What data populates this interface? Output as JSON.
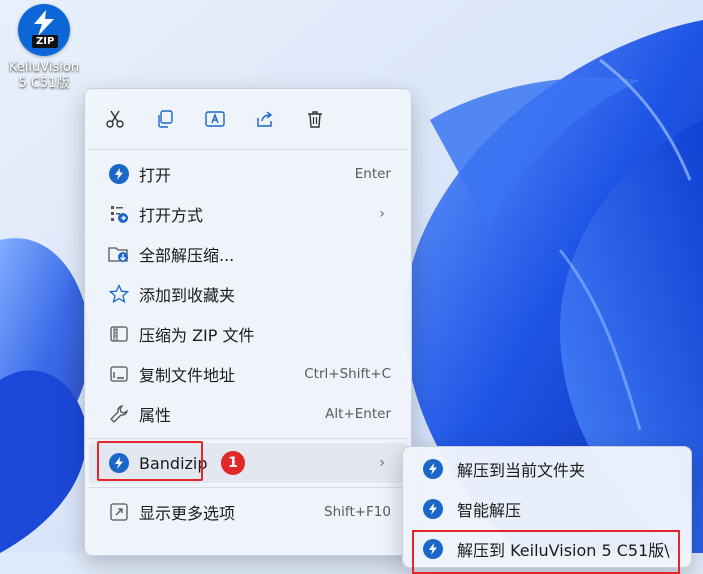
{
  "desktop": {
    "icon_label_line1": "KeiluVision",
    "icon_label_line2": "5 C51版",
    "icon_badge": "ZIP"
  },
  "toolbar": {
    "cut_icon": "scissors-icon",
    "copy_icon": "copy-icon",
    "rename_icon": "rename-icon",
    "share_icon": "share-icon",
    "delete_icon": "trash-icon"
  },
  "menu": {
    "items": [
      {
        "label": "打开",
        "shortcut": "Enter",
        "icon": "bandizip-icon"
      },
      {
        "label": "打开方式",
        "shortcut": "",
        "icon": "open-with-icon",
        "has_submenu": true
      },
      {
        "label": "全部解压缩...",
        "shortcut": "",
        "icon": "extract-all-icon"
      },
      {
        "label": "添加到收藏夹",
        "shortcut": "",
        "icon": "star-icon"
      },
      {
        "label": "压缩为 ZIP 文件",
        "shortcut": "",
        "icon": "zip-file-icon"
      },
      {
        "label": "复制文件地址",
        "shortcut": "Ctrl+Shift+C",
        "icon": "copy-path-icon"
      },
      {
        "label": "属性",
        "shortcut": "Alt+Enter",
        "icon": "wrench-icon"
      }
    ],
    "bandizip": {
      "label": "Bandizip",
      "badge": "1",
      "arrow": "›"
    },
    "more": {
      "label": "显示更多选项",
      "shortcut": "Shift+F10"
    }
  },
  "submenu": {
    "items": [
      {
        "label": "解压到当前文件夹"
      },
      {
        "label": "智能解压"
      },
      {
        "label": "解压到 KeiluVision 5 C51版\\"
      }
    ]
  },
  "colors": {
    "accent": "#1a66c9",
    "highlight_box": "#e4262c",
    "wallpaper_blue": "#1b4fd8"
  }
}
